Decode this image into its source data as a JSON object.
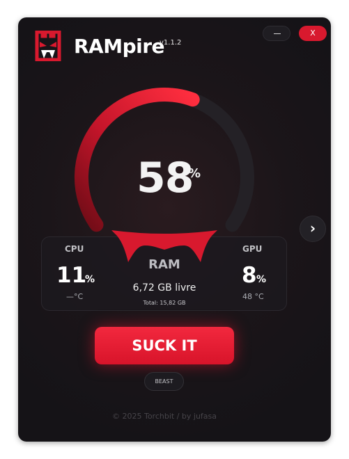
{
  "app": {
    "title": "RAMpire",
    "version": "v1.1.2"
  },
  "window_controls": {
    "minimize_label": "",
    "close_label": "X"
  },
  "gauge": {
    "value": "58",
    "unit": "%",
    "fill_fraction": 0.58,
    "accent": "#e8192e"
  },
  "cpu": {
    "label": "CPU",
    "value": "11",
    "unit": "%",
    "temp": "—°C"
  },
  "gpu": {
    "label": "GPU",
    "value": "8",
    "unit": "%",
    "temp": "48 °C"
  },
  "ram": {
    "label": "RAM",
    "free": "6,72 GB livre",
    "total": "Total: 15,82 GB"
  },
  "next_icon": "›",
  "action": {
    "label": "SUCK IT"
  },
  "mode": {
    "label": "BEAST"
  },
  "footer": {
    "text": "© 2025 Torchbit / by jufasa"
  },
  "colors": {
    "accent": "#e8192e",
    "background": "#18161a"
  }
}
